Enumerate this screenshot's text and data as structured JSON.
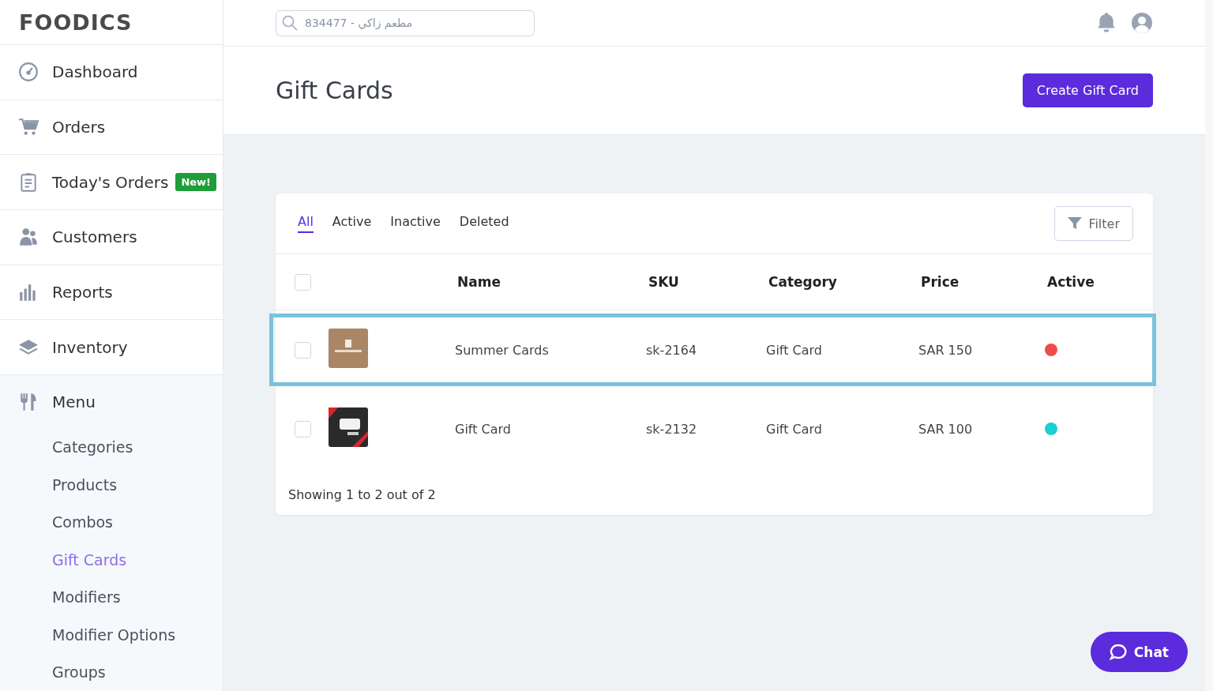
{
  "logo": "FOODICS",
  "search": {
    "placeholder": "مطعم زاكي - 834477"
  },
  "sidebar": {
    "items": [
      {
        "label": "Dashboard",
        "selected": false
      },
      {
        "label": "Orders",
        "selected": false
      },
      {
        "label": "Today's Orders",
        "selected": false,
        "badge": "New!"
      },
      {
        "label": "Customers",
        "selected": false
      },
      {
        "label": "Reports",
        "selected": false
      },
      {
        "label": "Inventory",
        "selected": false
      },
      {
        "label": "Menu",
        "selected": false,
        "children": [
          {
            "label": "Categories",
            "selected": false
          },
          {
            "label": "Products",
            "selected": false
          },
          {
            "label": "Combos",
            "selected": false
          },
          {
            "label": "Gift Cards",
            "selected": true
          },
          {
            "label": "Modifiers",
            "selected": false
          },
          {
            "label": "Modifier Options",
            "selected": false
          },
          {
            "label": "Groups",
            "selected": false
          }
        ]
      }
    ]
  },
  "page": {
    "title": "Gift Cards",
    "create_button": "Create Gift Card"
  },
  "tabs": [
    {
      "label": "All",
      "selected": true
    },
    {
      "label": "Active",
      "selected": false
    },
    {
      "label": "Inactive",
      "selected": false
    },
    {
      "label": "Deleted",
      "selected": false
    }
  ],
  "filter_button": "Filter",
  "table": {
    "columns": [
      "Name",
      "SKU",
      "Category",
      "Price",
      "Active"
    ],
    "select_all": {
      "checked": false
    },
    "rows": [
      {
        "checked": false,
        "highlighted": true,
        "name": "Summer Cards",
        "sku": "sk-2164",
        "category": "Gift Card",
        "price": "SAR 150",
        "color": "#ef4b4b"
      },
      {
        "checked": false,
        "highlighted": false,
        "name": "Gift Card",
        "sku": "sk-2132",
        "category": "Gift Card",
        "price": "SAR 100",
        "color": "#1ccfd1"
      }
    ]
  },
  "pagination": "Showing 1 to 2 out of 2",
  "chat_button": "Chat"
}
